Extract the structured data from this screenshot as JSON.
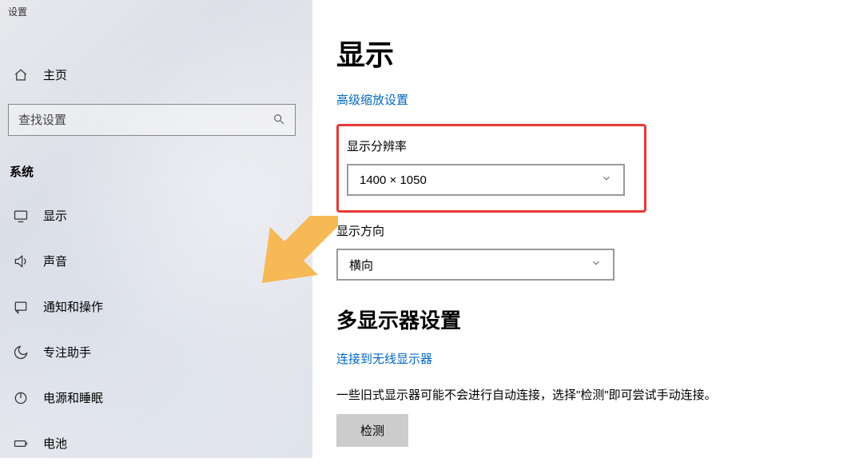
{
  "window": {
    "title": "设置"
  },
  "sidebar": {
    "home_label": "主页",
    "search_placeholder": "查找设置",
    "category_label": "系统",
    "items": [
      {
        "label": "显示",
        "icon": "display-icon"
      },
      {
        "label": "声音",
        "icon": "sound-icon"
      },
      {
        "label": "通知和操作",
        "icon": "notifications-icon"
      },
      {
        "label": "专注助手",
        "icon": "focus-assist-icon"
      },
      {
        "label": "电源和睡眠",
        "icon": "power-icon"
      },
      {
        "label": "电池",
        "icon": "battery-icon"
      }
    ]
  },
  "main": {
    "title": "显示",
    "advanced_scaling_link": "高级缩放设置",
    "resolution": {
      "label": "显示分辨率",
      "value": "1400 × 1050"
    },
    "orientation": {
      "label": "显示方向",
      "value": "横向"
    },
    "multi_display": {
      "title": "多显示器设置",
      "wireless_link": "连接到无线显示器",
      "detect_hint": "一些旧式显示器可能不会进行自动连接，选择\"检测\"即可尝试手动连接。",
      "detect_button": "检测"
    }
  },
  "annotation": {
    "highlight_color": "#e53935",
    "arrow_color": "#f7b955"
  }
}
